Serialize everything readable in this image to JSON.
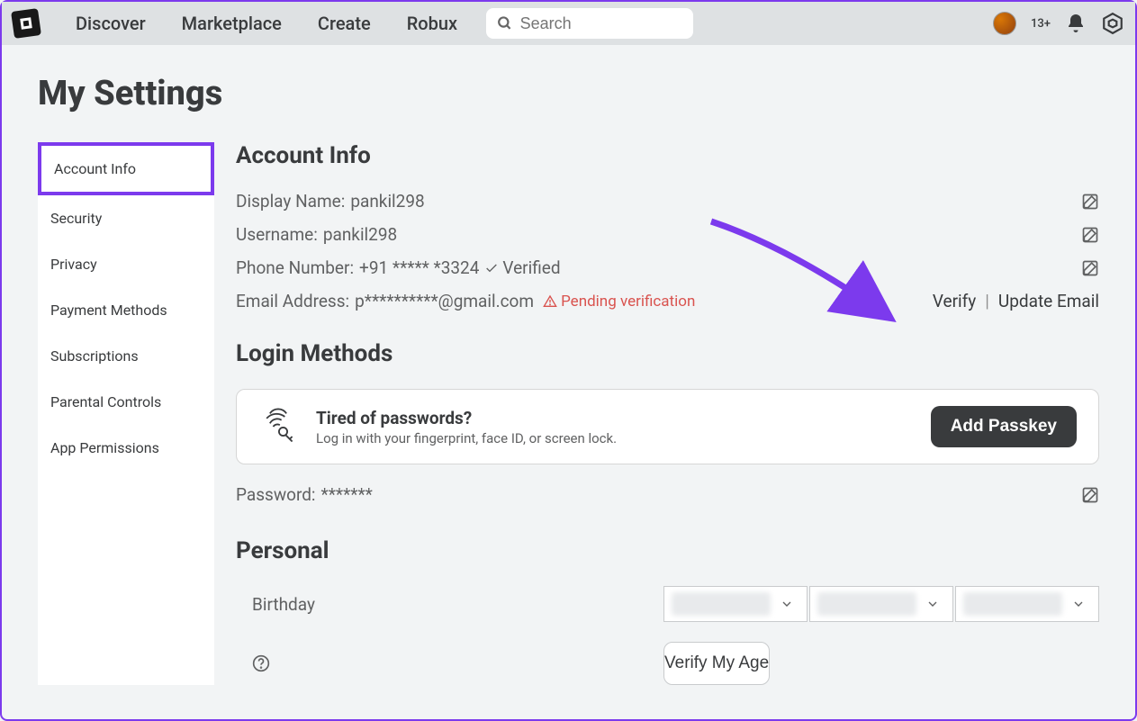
{
  "nav": {
    "links": [
      "Discover",
      "Marketplace",
      "Create",
      "Robux"
    ],
    "search_placeholder": "Search",
    "age_tag": "13+"
  },
  "page_title": "My Settings",
  "sidebar": {
    "items": [
      "Account Info",
      "Security",
      "Privacy",
      "Payment Methods",
      "Subscriptions",
      "Parental Controls",
      "App Permissions"
    ],
    "active_index": 0
  },
  "account_info": {
    "title": "Account Info",
    "display_name_label": "Display Name:",
    "display_name_value": "pankil298",
    "username_label": "Username:",
    "username_value": "pankil298",
    "phone_label": "Phone Number:",
    "phone_value": "+91 ***** *3324",
    "verified_text": "Verified",
    "email_label": "Email Address:",
    "email_value": "p**********@gmail.com",
    "pending_text": "Pending verification",
    "verify_action": "Verify",
    "update_email_action": "Update Email"
  },
  "login_methods": {
    "title": "Login Methods",
    "passkey_title": "Tired of passwords?",
    "passkey_sub": "Log in with your fingerprint, face ID, or screen lock.",
    "passkey_btn": "Add Passkey",
    "password_label": "Password:",
    "password_value": "*******"
  },
  "personal": {
    "title": "Personal",
    "birthday_label": "Birthday",
    "verify_age_btn": "Verify My Age"
  }
}
